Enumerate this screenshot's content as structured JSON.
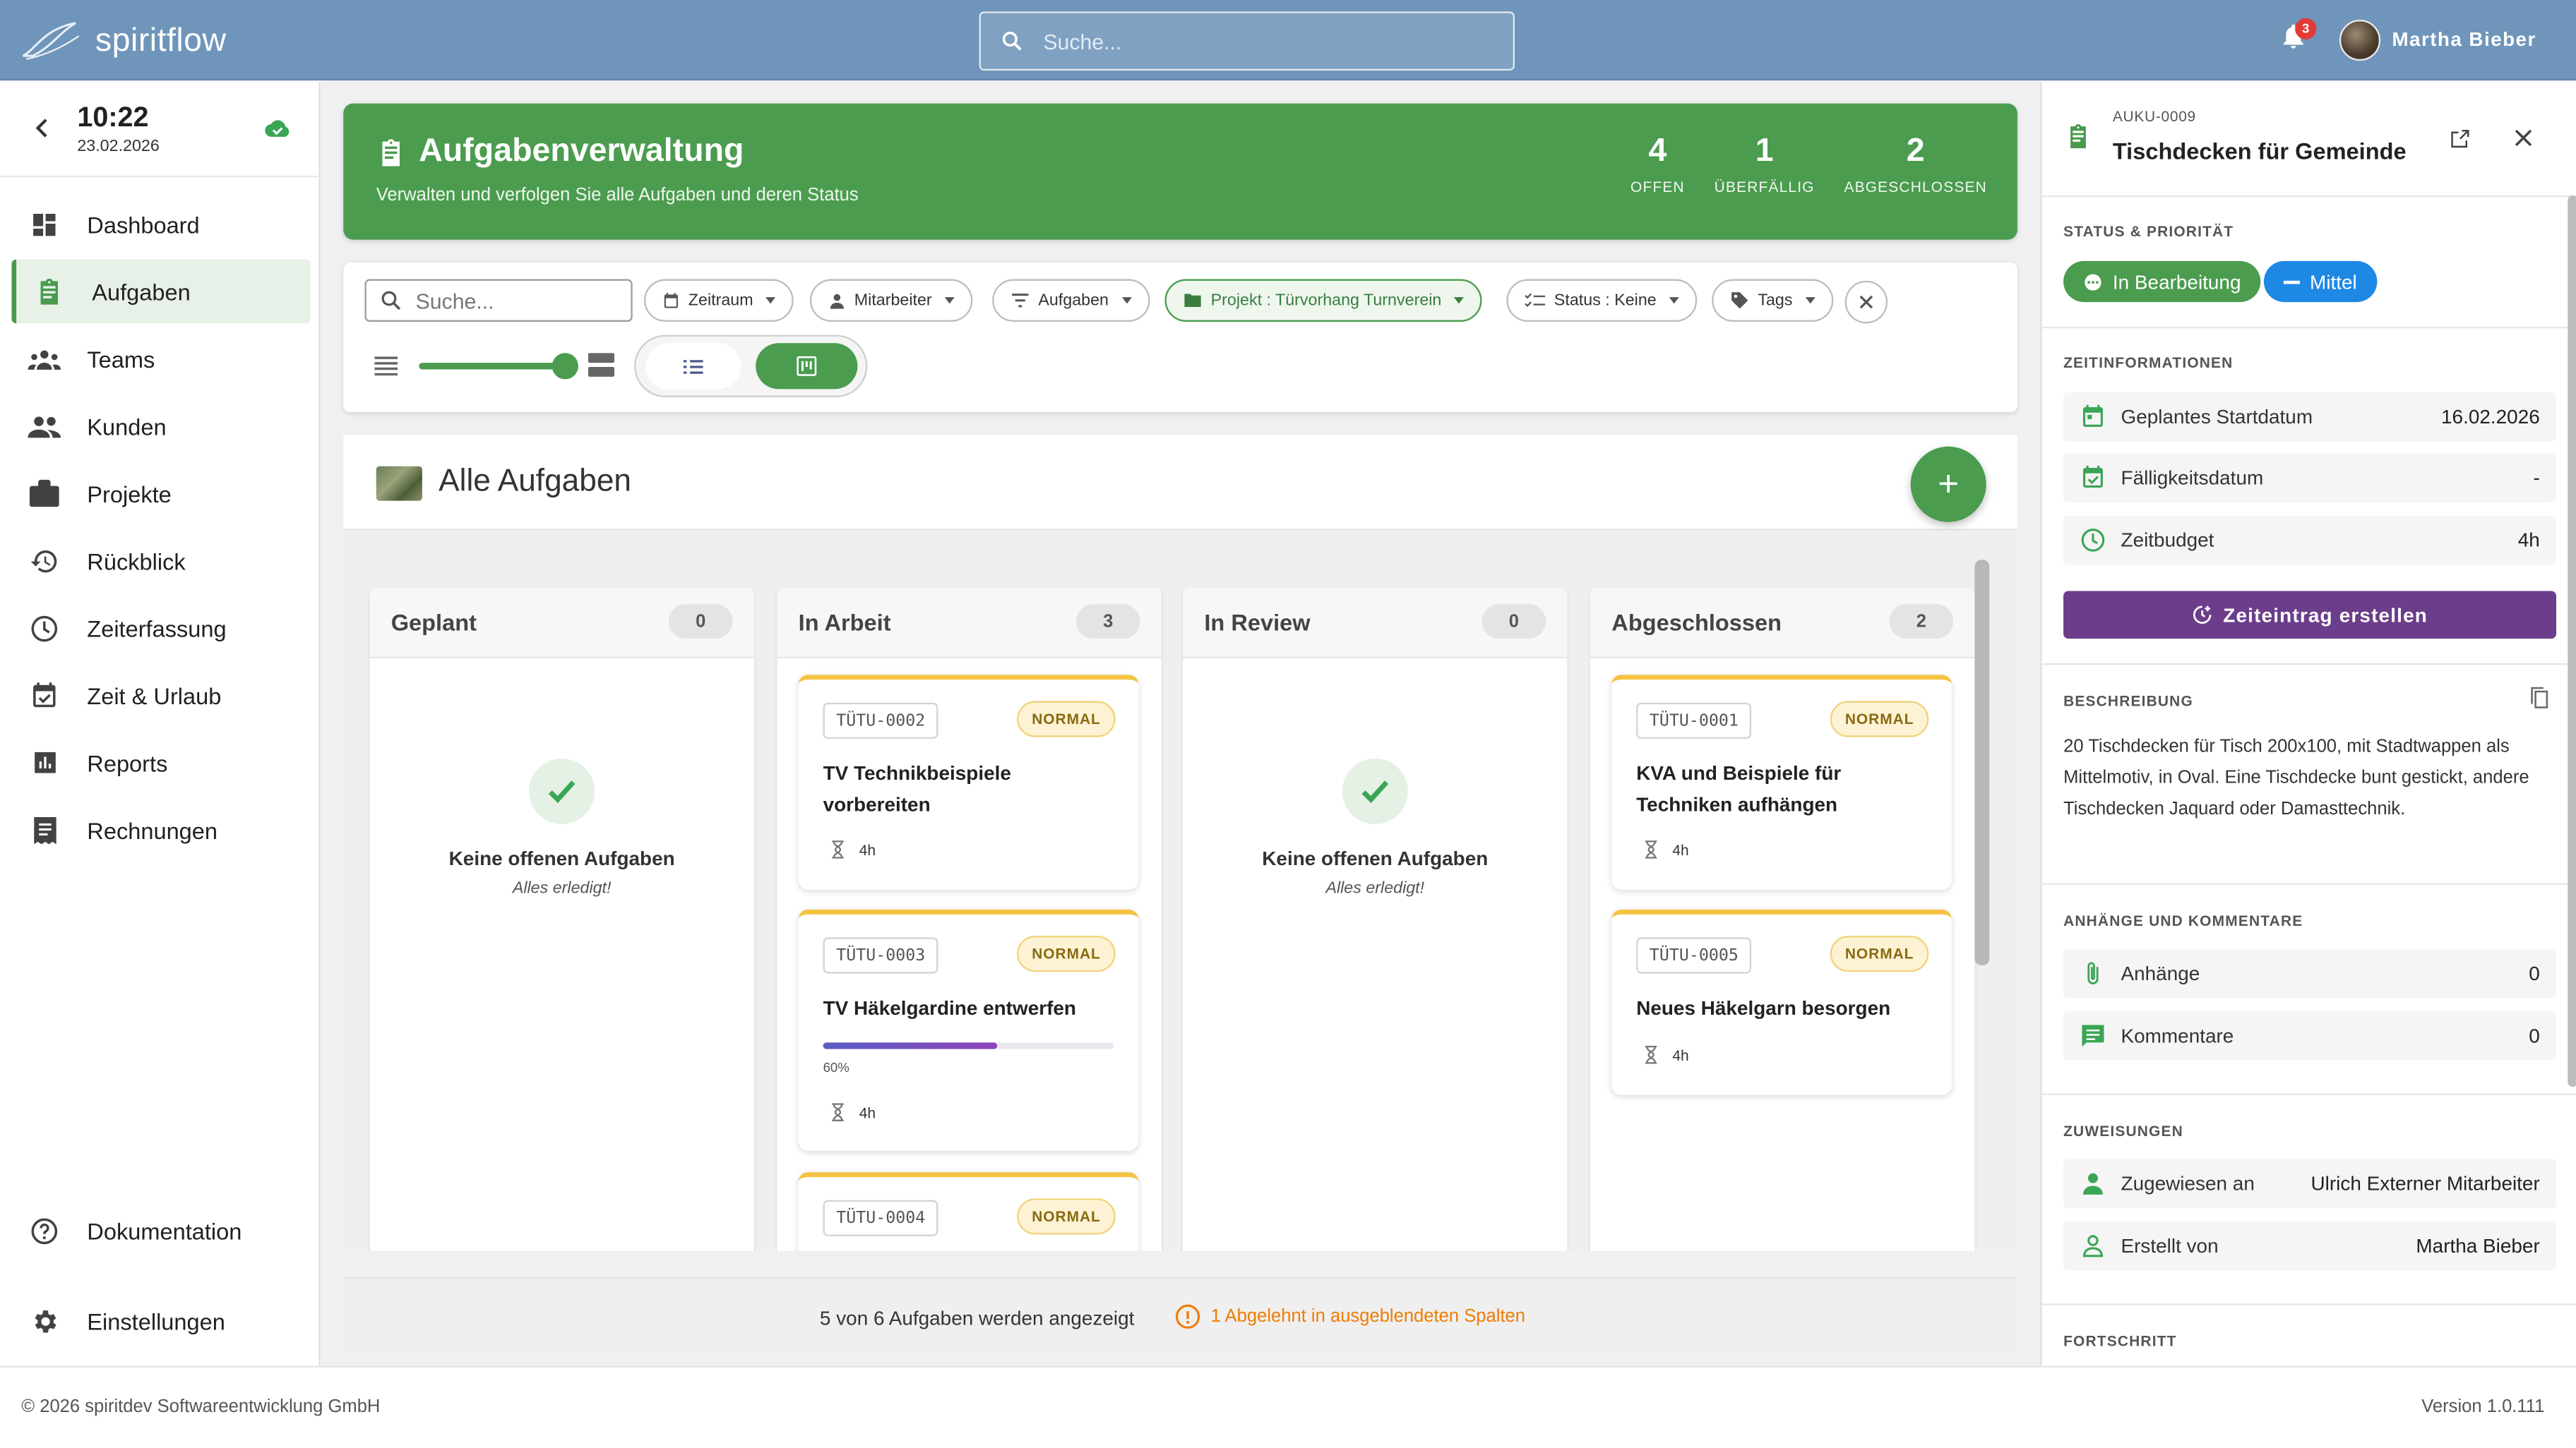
{
  "header": {
    "app_name": "spiritflow",
    "search_placeholder": "Suche...",
    "notification_count": "3",
    "user_name": "Martha Bieber"
  },
  "sidebar": {
    "time": "10:22",
    "date": "23.02.2026",
    "items": [
      {
        "label": "Dashboard",
        "icon": "dashboard-icon"
      },
      {
        "label": "Aufgaben",
        "icon": "clipboard-icon",
        "active": true
      },
      {
        "label": "Teams",
        "icon": "group-icon"
      },
      {
        "label": "Kunden",
        "icon": "people-icon"
      },
      {
        "label": "Projekte",
        "icon": "briefcase-icon"
      },
      {
        "label": "Rückblick",
        "icon": "history-icon"
      },
      {
        "label": "Zeiterfassung",
        "icon": "clock-icon"
      },
      {
        "label": "Zeit & Urlaub",
        "icon": "calendar-check-icon"
      },
      {
        "label": "Reports",
        "icon": "bar-chart-icon"
      },
      {
        "label": "Rechnungen",
        "icon": "receipt-icon"
      }
    ],
    "bottom": [
      {
        "label": "Dokumentation",
        "icon": "help-icon"
      },
      {
        "label": "Einstellungen",
        "icon": "gear-icon"
      }
    ]
  },
  "banner": {
    "title": "Aufgabenverwaltung",
    "subtitle": "Verwalten und verfolgen Sie alle Aufgaben und deren Status",
    "stats": [
      {
        "value": "4",
        "label": "OFFEN"
      },
      {
        "value": "1",
        "label": "ÜBERFÄLLIG"
      },
      {
        "value": "2",
        "label": "ABGESCHLOSSEN"
      }
    ]
  },
  "filters": {
    "search_placeholder": "Suche...",
    "chips": {
      "zeitraum": "Zeitraum",
      "mitarbeiter": "Mitarbeiter",
      "aufgaben": "Aufgaben",
      "projekt": "Projekt : Türvorhang Turnverein",
      "status": "Status : Keine",
      "tags": "Tags"
    },
    "density_slider": 0.9,
    "view_mode": "board"
  },
  "board": {
    "title": "Alle Aufgaben",
    "add_label": "+",
    "columns": [
      {
        "name": "Geplant",
        "count": "0",
        "empty_title": "Keine offenen Aufgaben",
        "empty_sub": "Alles erledigt!",
        "cards": []
      },
      {
        "name": "In Arbeit",
        "count": "3",
        "cards": [
          {
            "code": "TÜTU-0002",
            "priority": "NORMAL",
            "title": "TV Technikbeispiele vorbereiten",
            "time": "4h"
          },
          {
            "code": "TÜTU-0003",
            "priority": "NORMAL",
            "title": "TV Häkelgardine entwerfen",
            "progress": 0.6,
            "progress_label": "60%",
            "time": "4h"
          },
          {
            "code": "TÜTU-0004",
            "priority": "NORMAL"
          }
        ]
      },
      {
        "name": "In Review",
        "count": "0",
        "empty_title": "Keine offenen Aufgaben",
        "empty_sub": "Alles erledigt!",
        "cards": []
      },
      {
        "name": "Abgeschlossen",
        "count": "2",
        "cards": [
          {
            "code": "TÜTU-0001",
            "priority": "NORMAL",
            "title": "KVA und Beispiele für Techniken aufhängen",
            "time": "4h"
          },
          {
            "code": "TÜTU-0005",
            "priority": "NORMAL",
            "title": "Neues Häkelgarn besorgen",
            "time": "4h"
          }
        ]
      }
    ],
    "status_text": "5 von 6 Aufgaben werden angezeigt",
    "warning_text": "1 Abgelehnt in ausgeblendeten Spalten"
  },
  "detail": {
    "code": "AUKU-0009",
    "title": "Tischdecken für Gemeinde",
    "status_heading": "STATUS & PRIORITÄT",
    "status": "In Bearbeitung",
    "priority": "Mittel",
    "time_heading": "ZEITINFORMATIONEN",
    "time_rows": [
      {
        "label": "Geplantes Startdatum",
        "value": "16.02.2026"
      },
      {
        "label": "Fälligkeitsdatum",
        "value": "-"
      },
      {
        "label": "Zeitbudget",
        "value": "4h"
      }
    ],
    "time_button": "Zeiteintrag erstellen",
    "desc_heading": "BESCHREIBUNG",
    "description": "20 Tischdecken für Tisch 200x100, mit Stadtwappen als Mittelmotiv, in Oval. Eine Tischdecke bunt gestickt, andere Tischdecken Jaquard oder Damasttechnik.",
    "attach_heading": "ANHÄNGE UND KOMMENTARE",
    "attach_rows": [
      {
        "label": "Anhänge",
        "value": "0"
      },
      {
        "label": "Kommentare",
        "value": "0"
      }
    ],
    "assign_heading": "ZUWEISUNGEN",
    "assign_rows": [
      {
        "label": "Zugewiesen an",
        "value": "Ulrich Externer Mitarbeiter"
      },
      {
        "label": "Erstellt von",
        "value": "Martha Bieber"
      }
    ],
    "progress_heading": "FORTSCHRITT"
  },
  "footer": {
    "copyright": "© 2026 spiritdev Softwareentwicklung GmbH",
    "version": "Version 1.0.111"
  },
  "colors": {
    "header": "#6f95ba",
    "primary_green": "#4b9c4f",
    "purple_button": "#6b3d8a",
    "priority_blue": "#1e88e5",
    "warning": "#ef7c00"
  }
}
